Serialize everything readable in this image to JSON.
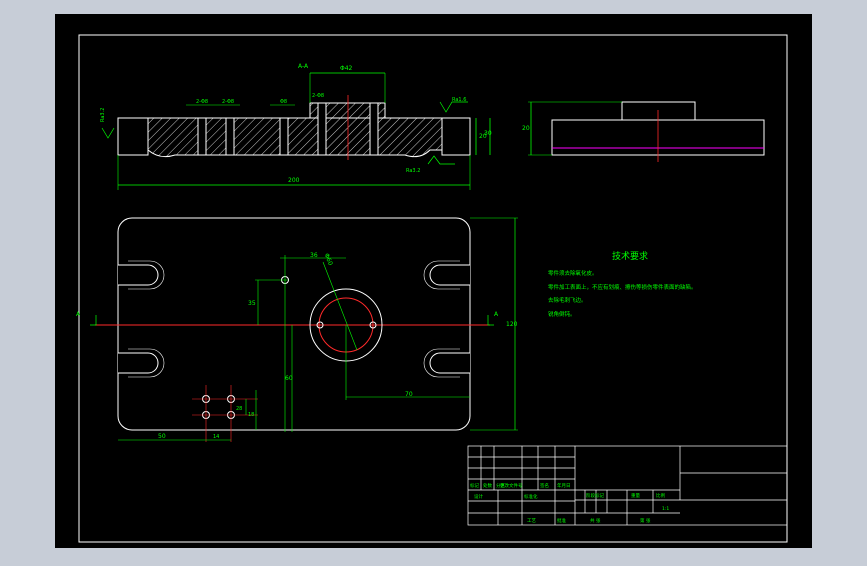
{
  "colors": {
    "background": "#c7cdd7",
    "sheet": "#000000",
    "outline": "#ffffff",
    "dimension": "#00ff00",
    "centerline": "#ff2a2a",
    "hatch": "#ffffff",
    "hidden_line": "#ff00ff",
    "note_text": "#00ff00"
  },
  "section_view": {
    "section_label": "A-A",
    "dimensions": {
      "overall_length": "200",
      "counterbore": "Φ42",
      "hole_1": "2-Φ8",
      "hole_2": "2-Φ8",
      "hole_3": "Φ8",
      "hole_4": "2-Φ8",
      "height_small": "20",
      "height_total": "30"
    },
    "roughness": {
      "left": "Ra3.2",
      "right_top": "Ra1.6",
      "bottom": "Ra3.2"
    }
  },
  "side_view": {
    "height_label": "20"
  },
  "plan_view": {
    "section_marker_left": "A",
    "section_marker_right": "A",
    "dimensions": {
      "d36": "36",
      "d35": "35",
      "bore_dia": "Φ60",
      "d60": "60",
      "d70": "70",
      "d50": "50",
      "d14": "14",
      "d28": "28",
      "d18": "18",
      "height": "120"
    }
  },
  "tech_requirements": {
    "title": "技术要求",
    "lines": [
      "零件须去除氧化皮。",
      "零件加工表面上，不应有划痕、擦伤等损伤零件表面的缺陷。",
      "去除毛刺飞边。",
      "锐角倒钝。"
    ]
  },
  "title_block": {
    "mark": "标记",
    "count": "处数",
    "zone": "分区",
    "change_doc": "更改文件号",
    "signature": "签名",
    "date": "年月日",
    "design": "设计",
    "standardize": "标准化",
    "stage_mark": "阶段标记",
    "weight": "重量",
    "scale": "比例",
    "scale_value": "1:1",
    "process": "工艺",
    "approve": "批准",
    "sheets_total": "共  张",
    "sheet_no": "第  张"
  }
}
